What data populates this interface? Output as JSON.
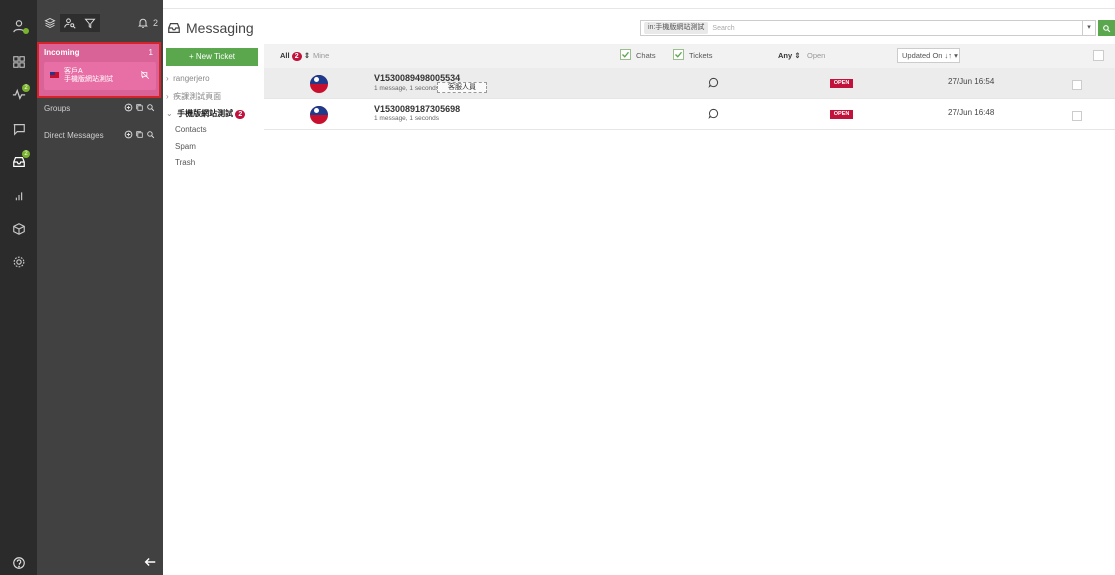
{
  "rail": {
    "items": [
      {
        "icon": "user-icon"
      },
      {
        "icon": "grid-icon"
      },
      {
        "icon": "activity-icon",
        "badge": "2"
      },
      {
        "icon": "chat-bubble-icon"
      },
      {
        "icon": "inbox-icon",
        "badge": "2"
      },
      {
        "icon": "bar-chart-icon"
      },
      {
        "icon": "box-icon"
      },
      {
        "icon": "settings-icon"
      }
    ],
    "help_icon": "help-icon"
  },
  "panel": {
    "top_buttons": [
      "layers-icon",
      "user-search-icon",
      "filter-icon"
    ],
    "bell_badge": "2",
    "incoming": {
      "title": "Incoming",
      "count": "1",
      "chat_name": "客戶A",
      "chat_sub": "手機版網站測試"
    },
    "groups_label": "Groups",
    "direct_label": "Direct Messages"
  },
  "header": {
    "title": "Messaging",
    "search_scope": "in:手機版網站測試",
    "search_placeholder": "Search",
    "dropdown": "▾"
  },
  "folders": {
    "new_ticket": "+ New Ticket",
    "items": [
      {
        "label": "rangerjero",
        "arrow": "›"
      },
      {
        "label": "疾課測試頁面",
        "arrow": "›"
      },
      {
        "label": "手機版網站測試",
        "arrow": "⌄",
        "badge": "2"
      }
    ],
    "contacts": "Contacts",
    "spam": "Spam",
    "trash": "Trash"
  },
  "filters": {
    "all_label": "All",
    "all_count": "2",
    "mine_label": "Mine",
    "sort_arrow": "⇕",
    "chats_label": "Chats",
    "tickets_label": "Tickets",
    "any_label": "Any",
    "open_label": "Open",
    "updated_label": "Updated On ↓↑ ▾"
  },
  "rows": [
    {
      "id": "V1530089498005534",
      "meta": "1 message, 1 seconds",
      "tag": "客服人員",
      "status": "OPEN",
      "date": "27/Jun 16:54"
    },
    {
      "id": "V1530089187305698",
      "meta": "1 message, 1 seconds",
      "tag": "",
      "status": "OPEN",
      "date": "27/Jun 16:48"
    }
  ],
  "colors": {
    "accent_green": "#5ba74e",
    "incoming_pink": "#d96296",
    "badge_red": "#c1123b",
    "rail_dark": "#2b2b2b"
  }
}
